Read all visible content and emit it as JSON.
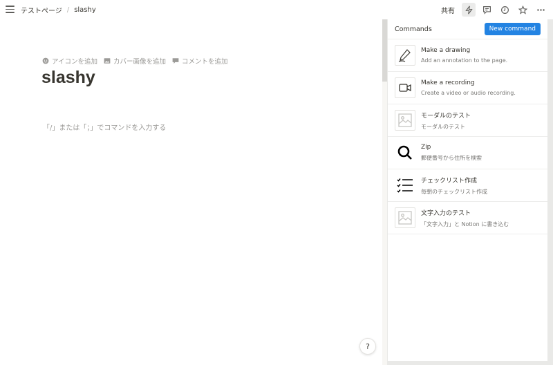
{
  "breadcrumb": {
    "parent": "テストページ",
    "separator": "/",
    "current": "slashy"
  },
  "top_actions": {
    "share_label": "共有"
  },
  "page": {
    "actions": [
      {
        "icon": "smile-icon",
        "label": "アイコンを追加"
      },
      {
        "icon": "image-icon",
        "label": "カバー画像を追加"
      },
      {
        "icon": "comment-icon",
        "label": "コメントを追加"
      }
    ],
    "title": "slashy",
    "placeholder": "「/」または「；」でコマンドを入力する"
  },
  "help": {
    "label": "?"
  },
  "panel": {
    "title": "Commands",
    "new_button": "New command",
    "commands": [
      {
        "icon": "pen-icon",
        "title": "Make a drawing",
        "desc": "Add an annotation to the page."
      },
      {
        "icon": "video-icon",
        "title": "Make a recording",
        "desc": "Create a video or audio recording."
      },
      {
        "icon": "image-placeholder-icon",
        "title": "モーダルのテスト",
        "desc": "モーダルのテスト"
      },
      {
        "icon": "magnifier-icon",
        "title": "Zip",
        "desc": "郵便番号から住所を検索"
      },
      {
        "icon": "checklist-icon",
        "title": "チェックリスト作成",
        "desc": "毎朝のチェックリスト作成"
      },
      {
        "icon": "image-placeholder-icon",
        "title": "文字入力のテスト",
        "desc": "「文字入力」と Notion に書き込む"
      }
    ]
  },
  "colors": {
    "accent": "#2383e2",
    "text": "#37352f",
    "muted": "#9b9a97"
  }
}
